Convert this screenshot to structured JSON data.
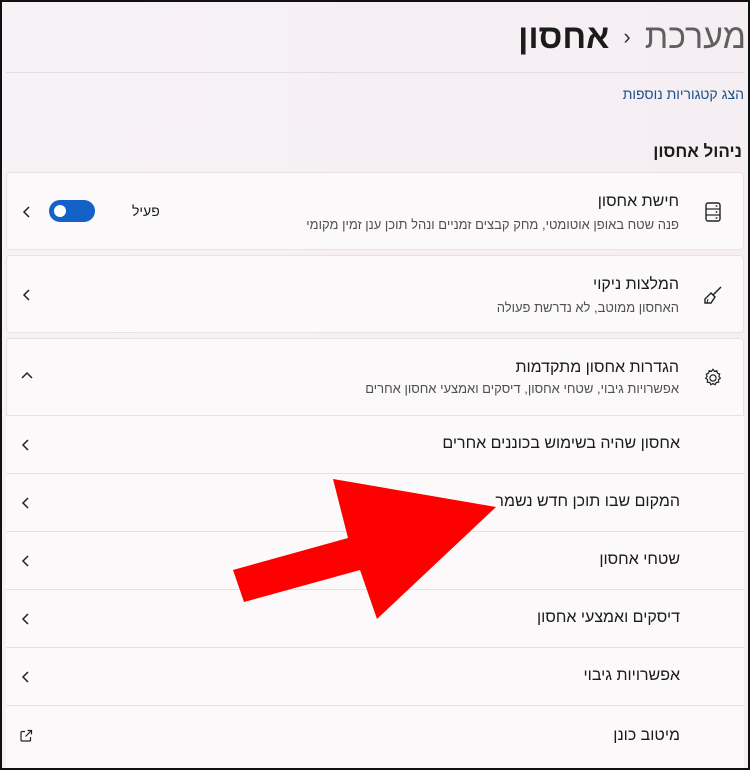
{
  "header": {
    "breadcrumb_root": "מערכת",
    "breadcrumb_separator": "›",
    "breadcrumb_current": "אחסון"
  },
  "more_categories_link": "הצג קטגוריות נוספות",
  "section_title": "ניהול אחסון",
  "storage_sense": {
    "title": "חישת אחסון",
    "subtitle": "פנה שטח באופן אוטומטי, מחק קבצים זמניים ונהל תוכן ענן זמין מקומי",
    "toggle_label": "פעיל",
    "toggle_state": "on",
    "icon": "storage-drive-icon"
  },
  "cleanup": {
    "title": "המלצות ניקוי",
    "subtitle": "האחסון ממוטב, לא נדרשת פעולה",
    "icon": "broom-icon"
  },
  "advanced": {
    "title": "הגדרות אחסון מתקדמות",
    "subtitle": "אפשרויות גיבוי, שטחי אחסון, דיסקים ואמצעי אחסון אחרים",
    "icon": "gear-icon",
    "expanded": true,
    "items": [
      {
        "label": "אחסון שהיה בשימוש בכוננים אחרים"
      },
      {
        "label": "המקום שבו תוכן חדש נשמר"
      },
      {
        "label": "שטחי אחסון"
      },
      {
        "label": "דיסקים ואמצעי אחסון"
      },
      {
        "label": "אפשרויות גיבוי"
      },
      {
        "label": "מיטוב כונן"
      }
    ]
  },
  "annotation": {
    "arrow_color": "#ff0000",
    "icon": "red-arrow-annotation"
  },
  "colors": {
    "accent": "#1461c7",
    "link": "#1a4f8a"
  }
}
